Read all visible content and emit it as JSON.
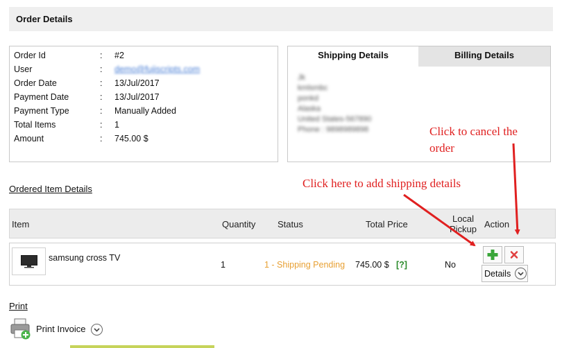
{
  "header": {
    "title": "Order Details"
  },
  "order_info": {
    "separator": ":",
    "rows": [
      {
        "label": "Order Id",
        "value": "#2"
      },
      {
        "label": "User",
        "value": "demo@fujiscripts.com"
      },
      {
        "label": "Order Date",
        "value": "13/Jul/2017"
      },
      {
        "label": "Payment Date",
        "value": "13/Jul/2017"
      },
      {
        "label": "Payment Type",
        "value": "Manually Added"
      },
      {
        "label": "Total Items",
        "value": "1"
      },
      {
        "label": "Amount",
        "value": "745.00 $"
      }
    ]
  },
  "address_tabs": {
    "tabs": [
      "Shipping Details",
      "Billing Details"
    ],
    "active": "Shipping Details",
    "address_lines": [
      "Jk",
      "kmlsmbc",
      "ponkd",
      "Alaska",
      "United States-567890",
      "Phone : 9898989898"
    ]
  },
  "annotations": {
    "cancel_line1": "Click to cancel the",
    "cancel_line2": "order",
    "shipping": "Click here to add shipping details",
    "color": "#e02020"
  },
  "ordered_items": {
    "section_link": "Ordered Item Details",
    "columns": [
      "Item",
      "Quantity",
      "Status",
      "Total Price",
      "Local",
      "Pickup",
      "Action"
    ],
    "rows": [
      {
        "item": "samsung cross TV",
        "quantity": "1",
        "status": "1 - Shipping Pending",
        "price": "745.00 $",
        "help": "[?]",
        "local_pickup": "No",
        "details_label": "Details"
      }
    ],
    "status_color": "#e8a033",
    "help_color": "#2a8a2a"
  },
  "print": {
    "section_link": "Print",
    "invoice_label": "Print Invoice"
  }
}
